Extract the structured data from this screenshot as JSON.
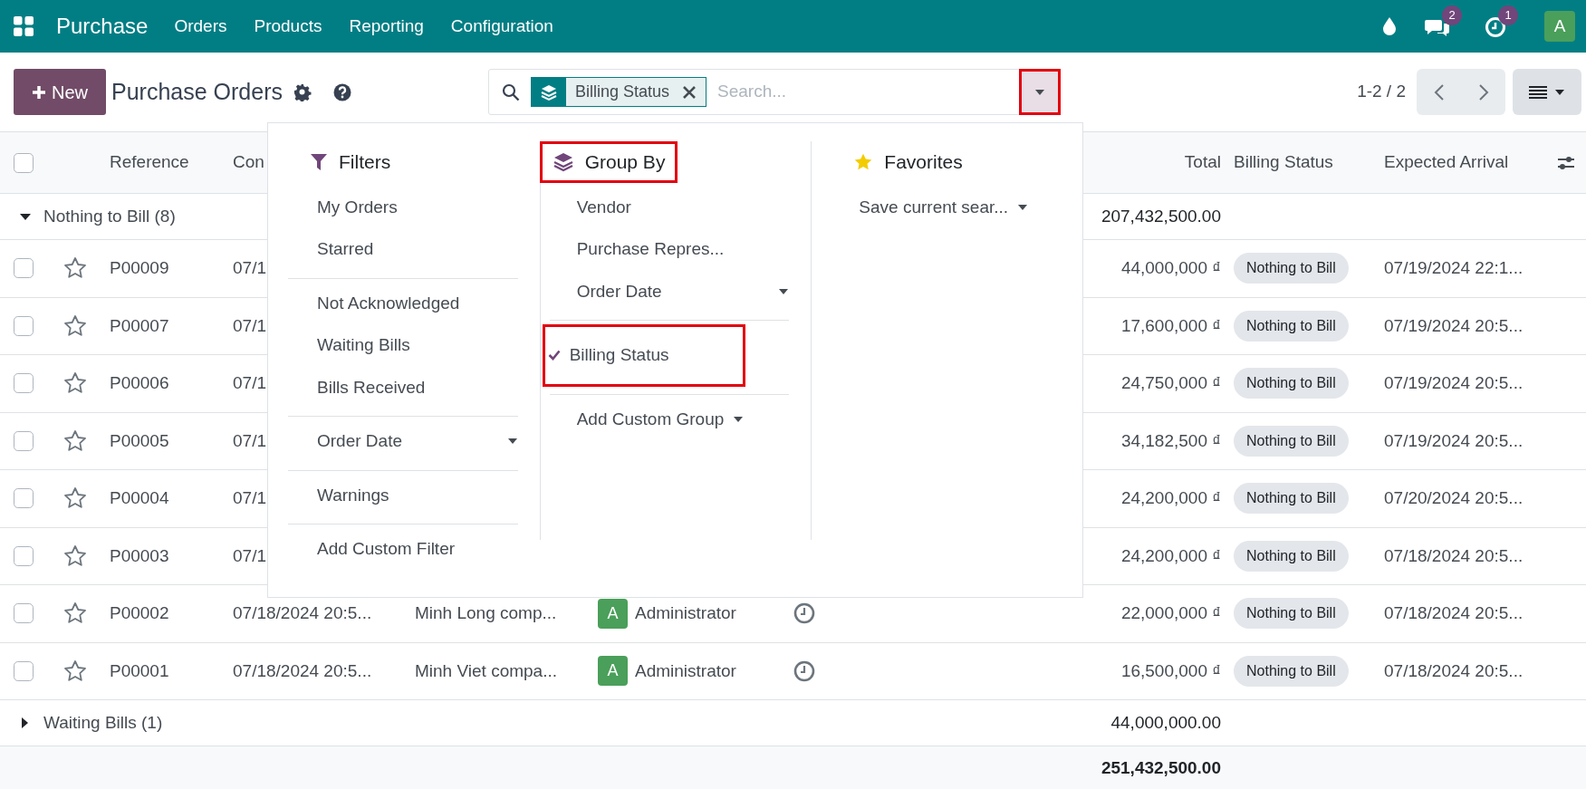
{
  "navbar": {
    "app_name": "Purchase",
    "menu": [
      "Orders",
      "Products",
      "Reporting",
      "Configuration"
    ],
    "messages_count": "2",
    "activities_count": "1",
    "avatar": "A"
  },
  "control_panel": {
    "new_button": "New",
    "title": "Purchase Orders",
    "facet": "Billing Status",
    "search_placeholder": "Search...",
    "toggle_highlighted": true,
    "pager": "1-2 / 2"
  },
  "search_panel": {
    "filters": {
      "title": "Filters",
      "sections": [
        [
          {
            "label": "My Orders",
            "kind": "option",
            "selected": false
          },
          {
            "label": "Starred",
            "kind": "option",
            "selected": false
          }
        ],
        [
          {
            "label": "Not Acknowledged",
            "kind": "option",
            "selected": false
          },
          {
            "label": "Waiting Bills",
            "kind": "option",
            "selected": false
          },
          {
            "label": "Bills Received",
            "kind": "option",
            "selected": false
          }
        ],
        [
          {
            "label": "Order Date",
            "kind": "submenu",
            "selected": false
          }
        ],
        [
          {
            "label": "Warnings",
            "kind": "option",
            "selected": false
          }
        ],
        [
          {
            "label": "Add Custom Filter",
            "kind": "option",
            "selected": false
          }
        ]
      ]
    },
    "group_by": {
      "title": "Group By",
      "highlighted": true,
      "sections": [
        [
          {
            "label": "Vendor",
            "kind": "option",
            "selected": false,
            "highlighted": false
          },
          {
            "label": "Purchase Repres...",
            "kind": "option",
            "selected": false,
            "highlighted": false
          },
          {
            "label": "Order Date",
            "kind": "submenu",
            "selected": false,
            "highlighted": false
          }
        ],
        [
          {
            "label": "Billing Status",
            "kind": "option",
            "selected": true,
            "highlighted": true
          }
        ],
        [
          {
            "label": "Add Custom Group",
            "kind": "submenu",
            "selected": false,
            "highlighted": false
          }
        ]
      ]
    },
    "favorites": {
      "title": "Favorites",
      "sections": [
        [
          {
            "label": "Save current sear...",
            "kind": "submenu",
            "selected": false
          }
        ]
      ]
    }
  },
  "table": {
    "all_checked": false,
    "columns": [
      "Reference",
      "Con",
      "Total",
      "Billing Status",
      "Expected Arrival"
    ],
    "groups": [
      {
        "label": "Nothing to Bill (8)",
        "expanded": true,
        "total": "207,432,500.00",
        "rows": [
          {
            "reference": "P00009",
            "column_2": "07/1",
            "total": "44,000,000 ₫",
            "billing_status": "Nothing to Bill",
            "expected_arrival": "07/19/2024 22:1...",
            "starred": false,
            "checked": false
          },
          {
            "reference": "P00007",
            "column_2": "07/1",
            "total": "17,600,000 ₫",
            "billing_status": "Nothing to Bill",
            "expected_arrival": "07/19/2024 20:5...",
            "starred": false,
            "checked": false
          },
          {
            "reference": "P00006",
            "column_2": "07/1",
            "total": "24,750,000 ₫",
            "billing_status": "Nothing to Bill",
            "expected_arrival": "07/19/2024 20:5...",
            "starred": false,
            "checked": false
          },
          {
            "reference": "P00005",
            "column_2": "07/1",
            "total": "34,182,500 ₫",
            "billing_status": "Nothing to Bill",
            "expected_arrival": "07/19/2024 20:5...",
            "starred": false,
            "checked": false
          },
          {
            "reference": "P00004",
            "column_2": "07/1",
            "total": "24,200,000 ₫",
            "billing_status": "Nothing to Bill",
            "expected_arrival": "07/20/2024 20:5...",
            "starred": false,
            "checked": false
          },
          {
            "reference": "P00003",
            "column_2": "07/1",
            "total": "24,200,000 ₫",
            "billing_status": "Nothing to Bill",
            "expected_arrival": "07/18/2024 20:5...",
            "starred": false,
            "checked": false
          },
          {
            "reference": "P00002",
            "column_2": "07/18/2024 20:5...",
            "column_3": "Minh Long comp...",
            "representative": {
              "initial": "A",
              "name": "Administrator"
            },
            "total": "22,000,000 ₫",
            "billing_status": "Nothing to Bill",
            "expected_arrival": "07/18/2024 20:5...",
            "starred": false,
            "checked": false
          },
          {
            "reference": "P00001",
            "column_2": "07/18/2024 20:5...",
            "column_3": "Minh Viet compa...",
            "representative": {
              "initial": "A",
              "name": "Administrator"
            },
            "total": "16,500,000 ₫",
            "billing_status": "Nothing to Bill",
            "expected_arrival": "07/18/2024 20:5...",
            "starred": false,
            "checked": false
          }
        ]
      },
      {
        "label": "Waiting Bills (1)",
        "expanded": false,
        "total": "44,000,000.00"
      }
    ],
    "grand_total": "251,432,500.00"
  }
}
